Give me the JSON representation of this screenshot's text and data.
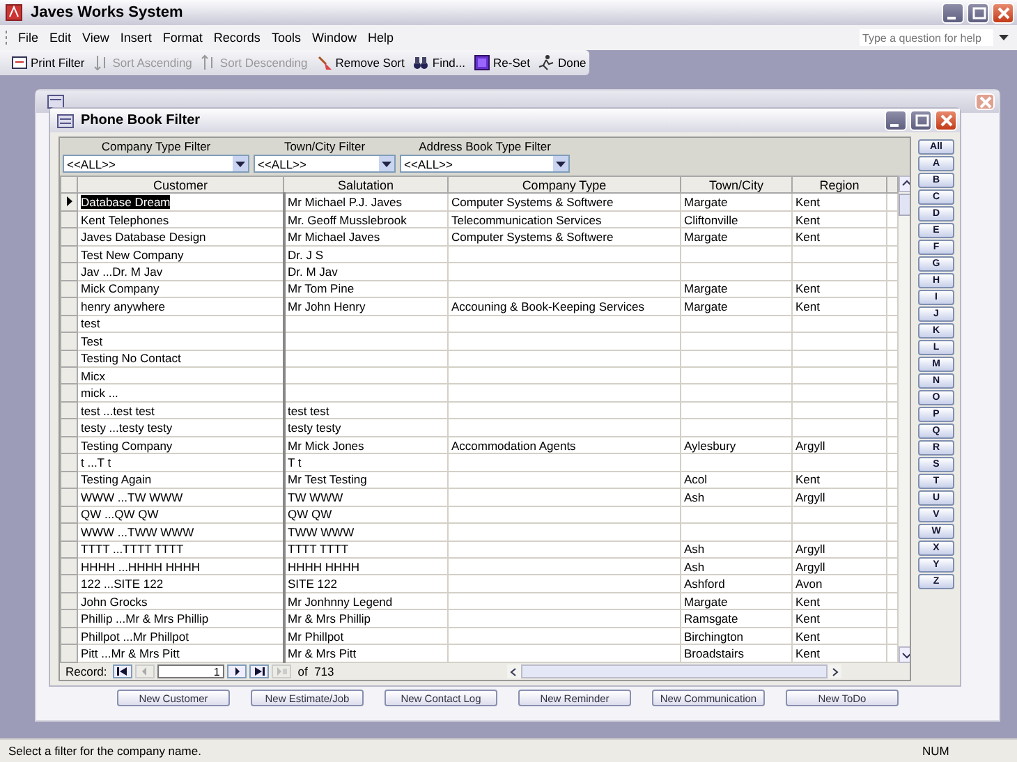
{
  "window": {
    "title": "Javes Works System"
  },
  "menu": [
    "File",
    "Edit",
    "View",
    "Insert",
    "Format",
    "Records",
    "Tools",
    "Window",
    "Help"
  ],
  "help_box": {
    "placeholder": "Type a question for help"
  },
  "toolbar": [
    {
      "label": "Print Filter",
      "disabled": false
    },
    {
      "label": "Sort Ascending",
      "disabled": true
    },
    {
      "label": "Sort Descending",
      "disabled": true
    },
    {
      "label": "Remove Sort",
      "disabled": false
    },
    {
      "label": "Find...",
      "disabled": false
    },
    {
      "label": "Re-Set",
      "disabled": false
    },
    {
      "label": "Done",
      "disabled": false
    }
  ],
  "background_window": {
    "buttons": [
      "New Customer",
      "New Estimate/Job",
      "New Contact Log",
      "New Reminder",
      "New Communication",
      "New ToDo"
    ]
  },
  "filter_window": {
    "title": "Phone Book Filter",
    "filters": [
      {
        "label": "Company Type Filter",
        "value": "<<ALL>>"
      },
      {
        "label": "Town/City Filter",
        "value": "<<ALL>>"
      },
      {
        "label": "Address Book Type Filter",
        "value": "<<ALL>>"
      }
    ],
    "columns": [
      "Customer",
      "Salutation",
      "Company Type",
      "Town/City",
      "Region"
    ],
    "rows": [
      {
        "selected": true,
        "cells": [
          "Database Dream",
          "Mr Michael P.J. Javes",
          "Computer Systems & Softwere",
          "Margate",
          "Kent"
        ]
      },
      {
        "selected": false,
        "cells": [
          "Kent Telephones",
          "Mr. Geoff Musslebrook",
          "Telecommunication Services",
          "Cliftonville",
          "Kent"
        ]
      },
      {
        "selected": false,
        "cells": [
          "Javes Database Design",
          "Mr Michael Javes",
          "Computer Systems & Softwere",
          "Margate",
          "Kent"
        ]
      },
      {
        "selected": false,
        "cells": [
          "Test New Company",
          "Dr. J S",
          "",
          "",
          ""
        ]
      },
      {
        "selected": false,
        "cells": [
          "Jav ...Dr. M Jav",
          "Dr. M Jav",
          "",
          "",
          ""
        ]
      },
      {
        "selected": false,
        "cells": [
          "Mick Company",
          "Mr Tom Pine",
          "",
          "Margate",
          "Kent"
        ]
      },
      {
        "selected": false,
        "cells": [
          "henry anywhere",
          "Mr John Henry",
          "Accouning & Book-Keeping Services",
          "Margate",
          "Kent"
        ]
      },
      {
        "selected": false,
        "cells": [
          "test",
          "",
          "",
          "",
          ""
        ]
      },
      {
        "selected": false,
        "cells": [
          "Test",
          "",
          "",
          "",
          ""
        ]
      },
      {
        "selected": false,
        "cells": [
          "Testing No Contact",
          "",
          "",
          "",
          ""
        ]
      },
      {
        "selected": false,
        "cells": [
          "Micx",
          "",
          "",
          "",
          ""
        ]
      },
      {
        "selected": false,
        "cells": [
          "mick ...",
          "",
          "",
          "",
          ""
        ]
      },
      {
        "selected": false,
        "cells": [
          "test ...test test",
          "test test",
          "",
          "",
          ""
        ]
      },
      {
        "selected": false,
        "cells": [
          "testy ...testy testy",
          "testy testy",
          "",
          "",
          ""
        ]
      },
      {
        "selected": false,
        "cells": [
          "Testing Company",
          "Mr Mick Jones",
          "Accommodation Agents",
          "Aylesbury",
          "Argyll"
        ]
      },
      {
        "selected": false,
        "cells": [
          "t ...T t",
          "T t",
          "",
          "",
          ""
        ]
      },
      {
        "selected": false,
        "cells": [
          "Testing Again",
          "Mr Test Testing",
          "",
          "Acol",
          "Kent"
        ]
      },
      {
        "selected": false,
        "cells": [
          "WWW ...TW WWW",
          "TW WWW",
          "",
          "Ash",
          "Argyll"
        ]
      },
      {
        "selected": false,
        "cells": [
          "QW ...QW QW",
          "QW QW",
          "",
          "",
          ""
        ]
      },
      {
        "selected": false,
        "cells": [
          "WWW ...TWW WWW",
          "TWW WWW",
          "",
          "",
          ""
        ]
      },
      {
        "selected": false,
        "cells": [
          "TTTT ...TTTT TTTT",
          "TTTT TTTT",
          "",
          "Ash",
          "Argyll"
        ]
      },
      {
        "selected": false,
        "cells": [
          "HHHH ...HHHH HHHH",
          "HHHH HHHH",
          "",
          "Ash",
          "Argyll"
        ]
      },
      {
        "selected": false,
        "cells": [
          "122 ...SITE 122",
          "SITE 122",
          "",
          "Ashford",
          "Avon"
        ]
      },
      {
        "selected": false,
        "cells": [
          "John Grocks",
          "Mr Jonhnny Legend",
          "",
          "Margate",
          "Kent"
        ]
      },
      {
        "selected": false,
        "cells": [
          "Phillip ...Mr & Mrs Phillip",
          "Mr & Mrs Phillip",
          "",
          "Ramsgate",
          "Kent"
        ]
      },
      {
        "selected": false,
        "cells": [
          "Phillpot ...Mr Phillpot",
          "Mr Phillpot",
          "",
          "Birchington",
          "Kent"
        ]
      },
      {
        "selected": false,
        "cells": [
          "Pitt ...Mr & Mrs Pitt",
          "Mr & Mrs Pitt",
          "",
          "Broadstairs",
          "Kent"
        ]
      }
    ],
    "record_nav": {
      "label": "Record:",
      "value": "1",
      "total": "of  713"
    },
    "letters": [
      "All",
      "A",
      "B",
      "C",
      "D",
      "E",
      "F",
      "G",
      "H",
      "I",
      "J",
      "K",
      "L",
      "M",
      "N",
      "O",
      "P",
      "Q",
      "R",
      "S",
      "T",
      "U",
      "V",
      "W",
      "X",
      "Y",
      "Z"
    ]
  },
  "status_bar": {
    "message": "Select a filter for the company name.",
    "indicator": "NUM"
  }
}
